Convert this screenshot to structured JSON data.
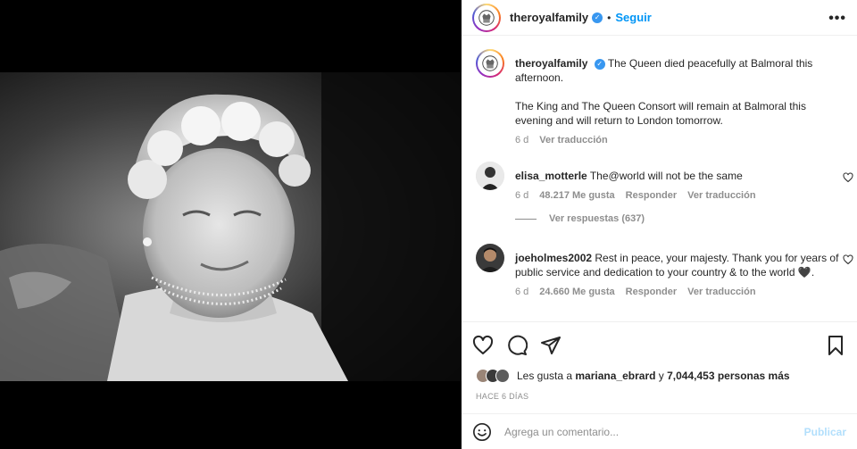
{
  "post": {
    "username": "theroyalfamily",
    "follow_label": "Seguir",
    "dot": "•",
    "more_label": "•••",
    "caption_para1": "The Queen died peacefully at Balmoral this afternoon.",
    "caption_para2": "The King and The Queen Consort will remain at Balmoral this evening and will return to London tomorrow.",
    "caption_time": "6 d",
    "translate_label": "Ver traducción"
  },
  "comments": [
    {
      "username": "elisa_motterle",
      "text": "The@world will not be the same",
      "time": "6 d",
      "likes": "48.217 Me gusta",
      "reply_label": "Responder",
      "translate_label": "Ver traducción",
      "replies_label": "Ver respuestas (637)"
    },
    {
      "username": "joeholmes2002",
      "text": "Rest in peace, your majesty. Thank you for years of public service and dedication to your country & to the world",
      "emoji": "🖤",
      "time": "6 d",
      "likes": "24.660 Me gusta",
      "reply_label": "Responder",
      "translate_label": "Ver traducción"
    }
  ],
  "likes_bar": {
    "prefix": "Les gusta a",
    "user": "mariana_ebrard",
    "conj": "y",
    "count": "7,044,453 personas más"
  },
  "posted_ago": "HACE 6 DÍAS",
  "composer": {
    "placeholder": "Agrega un comentario...",
    "publish_label": "Publicar"
  },
  "colors": {
    "accent": "#0095f6",
    "publish_disabled": "#b2dffc",
    "verified": "#3897f0"
  },
  "icons": [
    "heart-icon",
    "comment-icon",
    "share-icon",
    "bookmark-icon",
    "emoji-icon",
    "verified-icon",
    "more-icon"
  ]
}
